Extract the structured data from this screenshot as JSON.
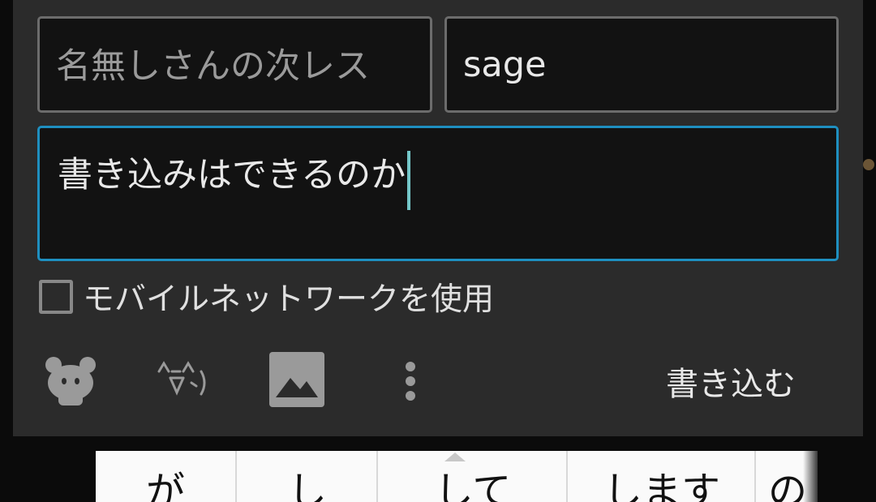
{
  "form": {
    "name_placeholder": "名無しさんの次レス",
    "mail_value": "sage",
    "message_value": "書き込みはできるのか",
    "mobile_network_label": "モバイルネットワークを使用",
    "submit_label": "書き込む"
  },
  "toolbar": {
    "icons": [
      "mascot-icon",
      "kaomoji-icon",
      "image-icon",
      "more-vert-icon"
    ]
  },
  "keyboard": {
    "candidates": [
      "が",
      "し",
      "して",
      "します",
      "の"
    ]
  },
  "colors": {
    "dialog_bg": "#2b2b2b",
    "field_bg": "#121212",
    "focus_border": "#1e8fc0",
    "caret": "#74c7c9"
  }
}
